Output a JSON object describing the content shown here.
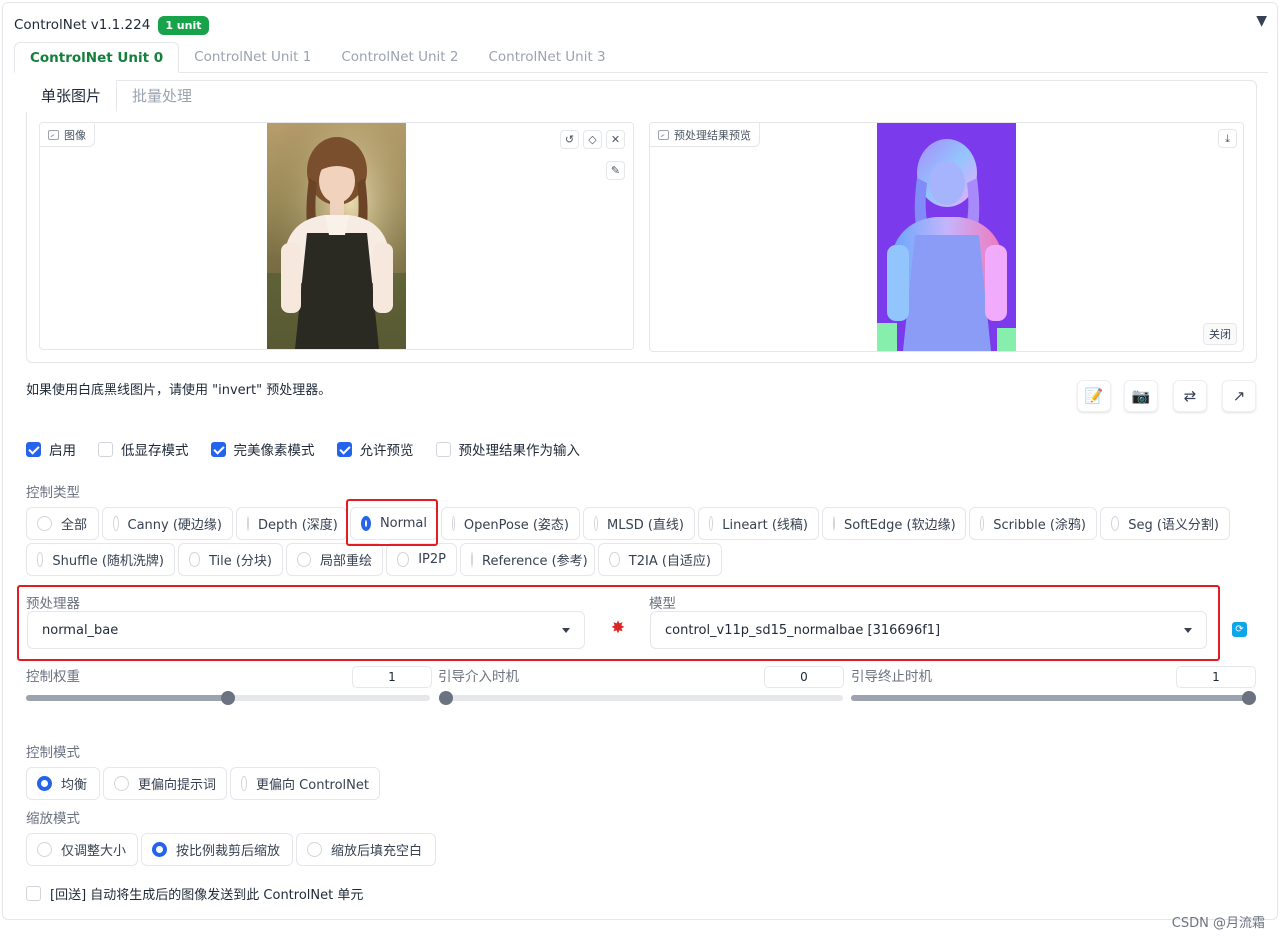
{
  "header": {
    "title": "ControlNet v1.1.224",
    "badge": "1 unit"
  },
  "unit_tabs": [
    "ControlNet Unit 0",
    "ControlNet Unit 1",
    "ControlNet Unit 2",
    "ControlNet Unit 3"
  ],
  "sub_tabs": [
    "单张图片",
    "批量处理"
  ],
  "image_panel": {
    "label": "图像"
  },
  "preview_panel": {
    "label": "预处理结果预览",
    "close": "关闭"
  },
  "hint": "如果使用白底黑线图片，请使用 \"invert\" 预处理器。",
  "checkboxes": [
    {
      "label": "启用",
      "checked": true
    },
    {
      "label": "低显存模式",
      "checked": false
    },
    {
      "label": "完美像素模式",
      "checked": true
    },
    {
      "label": "允许预览",
      "checked": true
    },
    {
      "label": "预处理结果作为输入",
      "checked": false
    }
  ],
  "control_type": {
    "label": "控制类型",
    "row1": [
      "全部",
      "Canny (硬边缘)",
      "Depth (深度)",
      "Normal",
      "OpenPose (姿态)",
      "MLSD (直线)",
      "Lineart (线稿)",
      "SoftEdge (软边缘)",
      "Scribble (涂鸦)",
      "Seg (语义分割)"
    ],
    "row2": [
      "Shuffle (随机洗牌)",
      "Tile (分块)",
      "局部重绘",
      "IP2P",
      "Reference (参考)",
      "T2IA (自适应)"
    ],
    "selected": "Normal"
  },
  "preprocessor": {
    "label": "预处理器",
    "value": "normal_bae"
  },
  "model": {
    "label": "模型",
    "value": "control_v11p_sd15_normalbae [316696f1]"
  },
  "sliders": [
    {
      "label": "控制权重",
      "value": "1",
      "fraction": 0.5
    },
    {
      "label": "引导介入时机",
      "value": "0",
      "fraction": 0
    },
    {
      "label": "引导终止时机",
      "value": "1",
      "fraction": 1
    }
  ],
  "control_mode": {
    "label": "控制模式",
    "options": [
      "均衡",
      "更偏向提示词",
      "更偏向 ControlNet"
    ],
    "selected": "均衡"
  },
  "resize_mode": {
    "label": "缩放模式",
    "options": [
      "仅调整大小",
      "按比例裁剪后缩放",
      "缩放后填充空白"
    ],
    "selected": "按比例裁剪后缩放"
  },
  "loopback": {
    "label": "[回送] 自动将生成后的图像发送到此 ControlNet 单元",
    "checked": false
  },
  "watermark": "CSDN @月流霜"
}
